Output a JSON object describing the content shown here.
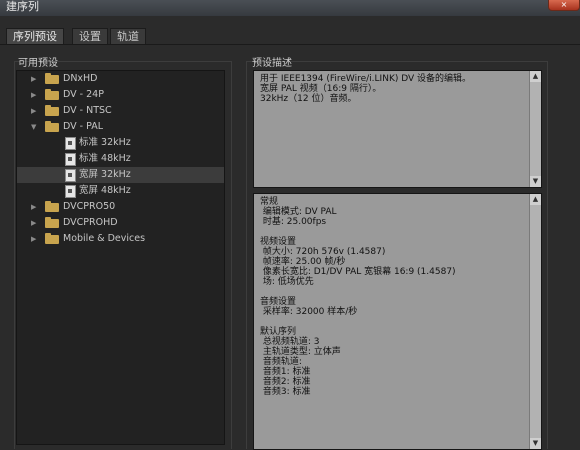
{
  "window": {
    "title": "建序列",
    "close_icon": "×"
  },
  "tabs": [
    {
      "label": "序列预设",
      "active": true
    },
    {
      "label": "设置",
      "active": false
    },
    {
      "label": "轨道",
      "active": false
    }
  ],
  "available_presets": {
    "label": "可用预设",
    "items": [
      {
        "label": "DNxHD",
        "type": "folder",
        "expanded": false
      },
      {
        "label": "DV - 24P",
        "type": "folder",
        "expanded": false
      },
      {
        "label": "DV - NTSC",
        "type": "folder",
        "expanded": false
      },
      {
        "label": "DV - PAL",
        "type": "folder",
        "expanded": true
      },
      {
        "label": "标准 32kHz",
        "type": "preset"
      },
      {
        "label": "标准 48kHz",
        "type": "preset"
      },
      {
        "label": "宽屏 32kHz",
        "type": "preset",
        "selected": true
      },
      {
        "label": "宽屏 48kHz",
        "type": "preset"
      },
      {
        "label": "DVCPRO50",
        "type": "folder",
        "expanded": false
      },
      {
        "label": "DVCPROHD",
        "type": "folder",
        "expanded": false
      },
      {
        "label": "Mobile & Devices",
        "type": "folder",
        "expanded": false
      }
    ]
  },
  "preset_description": {
    "label": "预设描述",
    "text": "用于 IEEE1394 (FireWire/i.LINK) DV 设备的编辑。\n宽屏 PAL 视频（16:9 隔行）。\n32kHz（12 位）音频。"
  },
  "details": {
    "text": "常规\n 编辑模式: DV PAL\n 时基: 25.00fps\n\n视频设置\n 帧大小: 720h 576v (1.4587)\n 帧速率: 25.00 帧/秒\n 像素长宽比: D1/DV PAL 宽银幕 16:9 (1.4587)\n 场: 低场优先\n\n音频设置\n 采样率: 32000 样本/秒\n\n默认序列\n 总视频轨道: 3\n 主轨道类型: 立体声\n 音频轨道:\n 音频1: 标准\n 音频2: 标准\n 音频3: 标准"
  },
  "colors": {
    "folder": "#c8a44e",
    "panel_bg": "#222222",
    "text_box_bg": "#9a9a9a"
  }
}
